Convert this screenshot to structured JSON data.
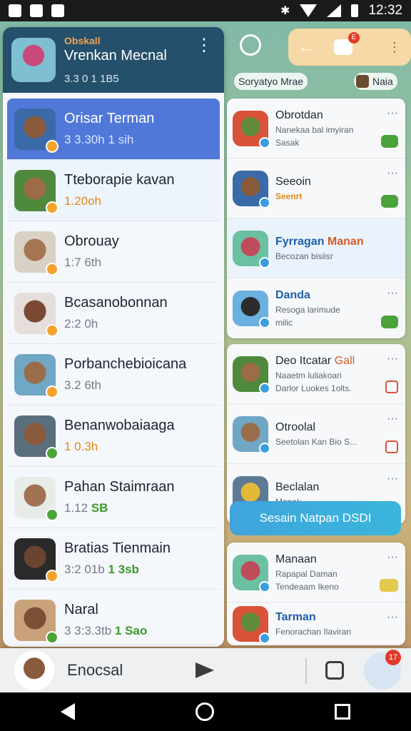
{
  "status_bar": {
    "time": "12:32"
  },
  "left_panel": {
    "header": {
      "subtitle": "Obskall",
      "name": "Vrenkan Mecnal",
      "time": "3.3 0 1 1B5"
    },
    "chats": [
      {
        "name": "Orisar Terman",
        "time": "3 3.30h 1 sih",
        "tag": ""
      },
      {
        "name": "Tteborapie kavan",
        "time": "1.20oh",
        "tag": ""
      },
      {
        "name": "Obrouay",
        "time": "1:7 6th",
        "tag": ""
      },
      {
        "name": "Bcasanobonnan",
        "time": "2:2 0h",
        "tag": ""
      },
      {
        "name": "Porbanchebioicana",
        "time": "3.2 6th",
        "tag": ""
      },
      {
        "name": "Benanwobaiaaga",
        "time": "1 0.3h",
        "tag": ""
      },
      {
        "name": "Pahan Staimraan",
        "time": "1.12",
        "tag": "SB"
      },
      {
        "name": "Bratias Tienmain",
        "time": "3:2 01b",
        "tag": "1 3sb"
      },
      {
        "name": "Naral",
        "time": "3 3:3.3tb",
        "tag": "1 Sao"
      }
    ]
  },
  "right_panel": {
    "chip_search": "Soryatyo Mrae",
    "chip_user": "Naia",
    "items": [
      {
        "name": "Obrotdan",
        "line1": "Nanekaa bal imyiran",
        "line2": "Sasak"
      },
      {
        "name": "Seeoin",
        "line1": "Seenrt",
        "line2": ""
      },
      {
        "name": "Fyrragan",
        "name_accent": "Manan",
        "line1": "Becozan bisiisr",
        "line2": ""
      },
      {
        "name": "Danda",
        "line1": "Resoga larimude",
        "line2": "milic"
      },
      {
        "name": "Deo Itcatar",
        "name_accent": "Gall",
        "line1": "Naaetm luliakoari",
        "line2": "Darlor   Luokes 1olts."
      },
      {
        "name": "Otroolal",
        "line1": "Seetolan  Kan Bio S...",
        "line2": ""
      },
      {
        "name": "Beclalan",
        "line1": "Manak",
        "line2": ""
      },
      {
        "name": "Manaan",
        "line1": "Rapapal Daman",
        "line2": "Tendeaam  Ikeno"
      },
      {
        "name": "Tarman",
        "line1": "Fenorachan Ilaviran",
        "line2": ""
      }
    ],
    "cta": "Sesain Natpan DSDI"
  },
  "composer": {
    "label": "Enocsal",
    "fab_count": "17"
  },
  "top_actions": {
    "notif_count": "E"
  }
}
